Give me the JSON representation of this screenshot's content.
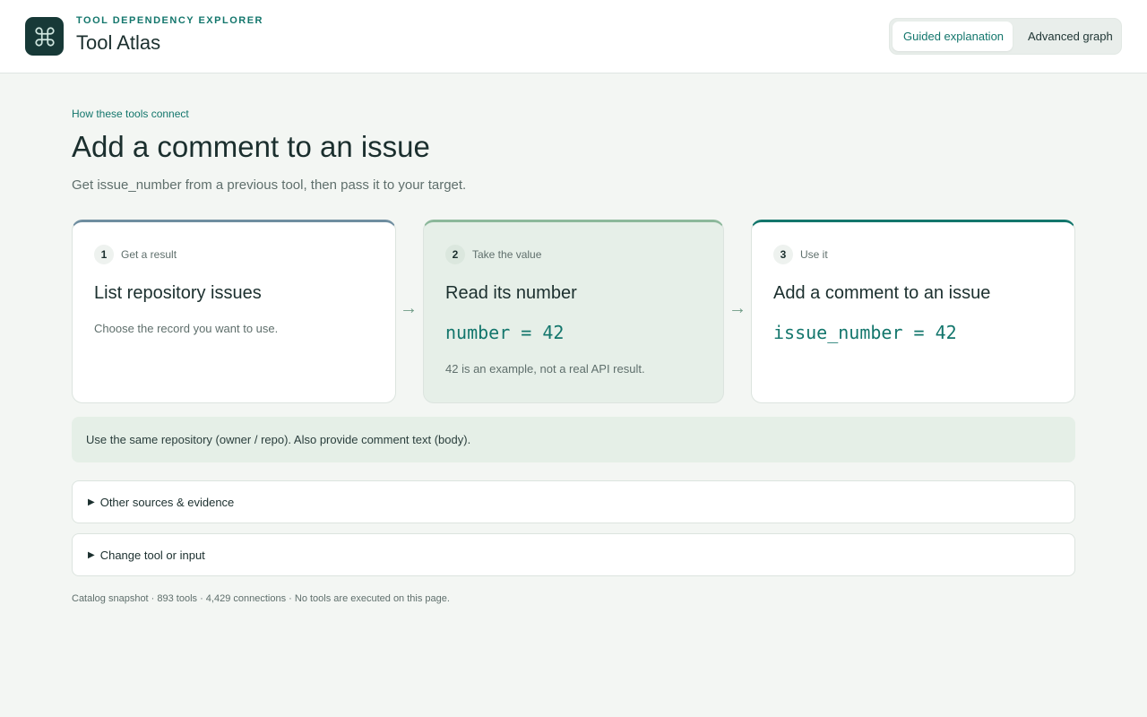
{
  "header": {
    "eyebrow": "TOOL DEPENDENCY EXPLORER",
    "app_title": "Tool Atlas",
    "logo_icon": "command-icon",
    "view_toggle": {
      "active": "Guided explanation",
      "inactive": "Advanced graph"
    }
  },
  "main": {
    "kicker": "How these tools connect",
    "title": "Add a comment to an issue",
    "subtitle": "Get issue_number from a previous tool, then pass it to your target.",
    "steps": [
      {
        "number": "1",
        "label": "Get a result",
        "title": "List repository issues",
        "description": "Choose the record you want to use."
      },
      {
        "number": "2",
        "label": "Take the value",
        "title": "Read its number",
        "code": "number = 42",
        "note": "42 is an example, not a real API result."
      },
      {
        "number": "3",
        "label": "Use it",
        "title": "Add a comment to an issue",
        "code": "issue_number = 42"
      }
    ],
    "arrow_glyph": "→",
    "hint": "Use the same repository (owner / repo). Also provide comment text (body).",
    "sections": [
      {
        "label": "Other sources & evidence"
      },
      {
        "label": "Change tool or input"
      }
    ],
    "footer": "Catalog snapshot · 893 tools · 4,429 connections · No tools are executed on this page."
  },
  "colors": {
    "accent": "#13766c",
    "logo_bg": "#173937",
    "page_bg": "#f3f6f3",
    "step1_border": "#6f8ea0",
    "step2_border": "#8cb89b",
    "step3_border": "#13766c"
  }
}
